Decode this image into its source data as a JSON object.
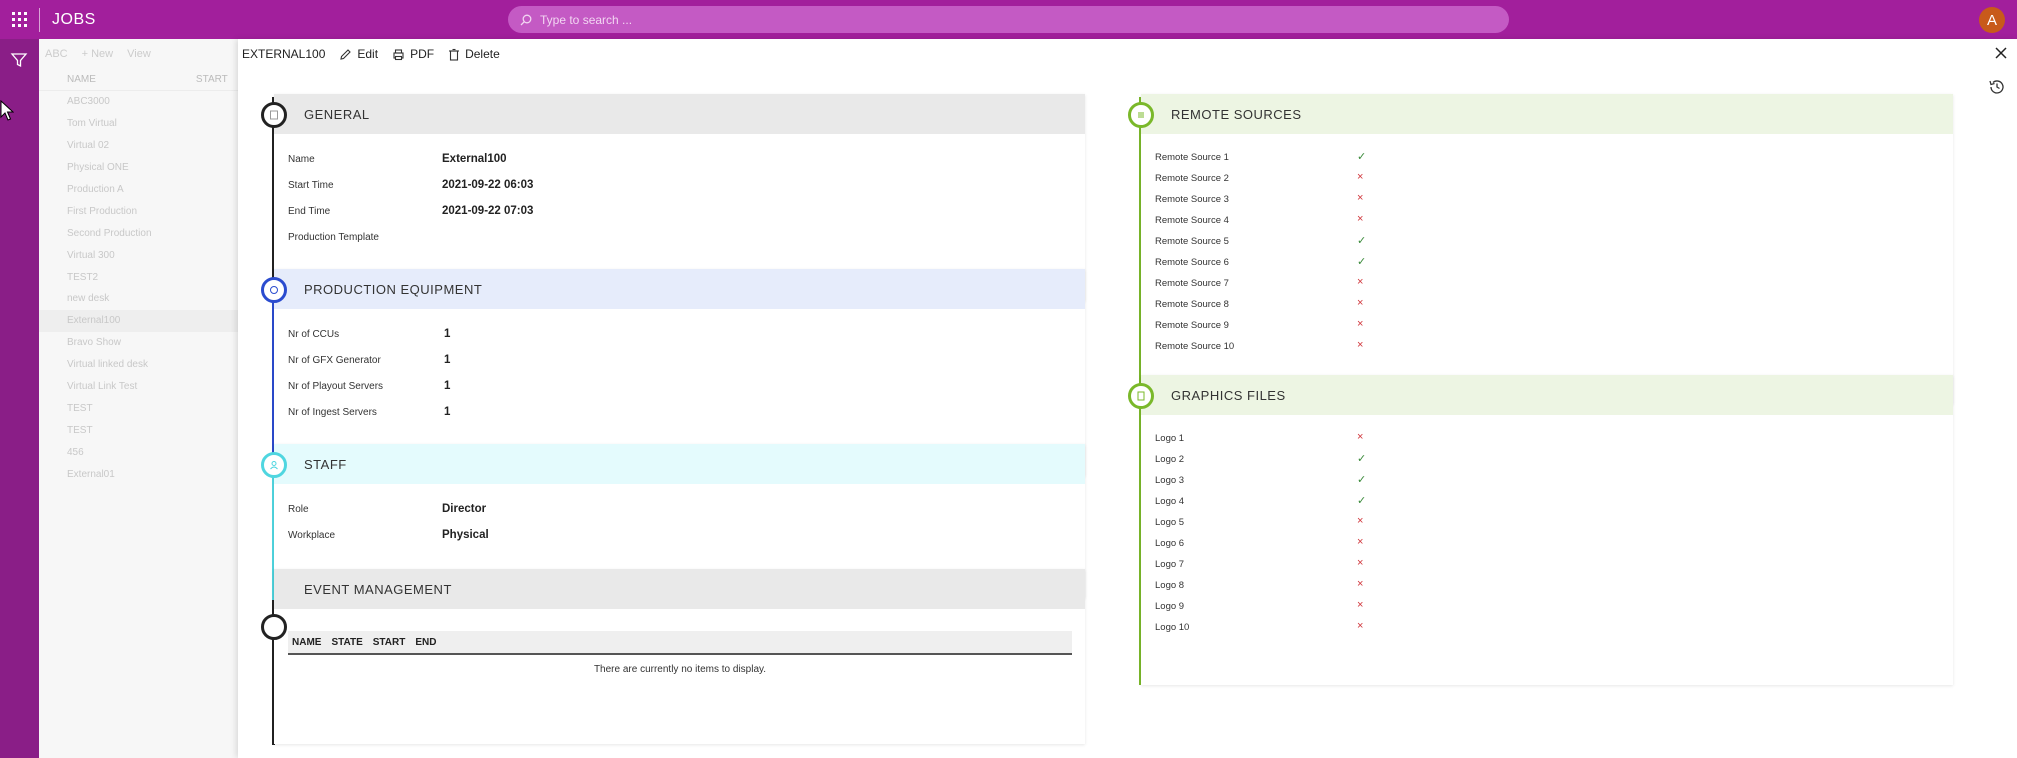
{
  "app": {
    "title": "JOBS",
    "search_placeholder": "Type to search ...",
    "avatar_initial": "A"
  },
  "list": {
    "toolbar": [
      "ABC",
      "New",
      "View"
    ],
    "columns": [
      "NAME",
      "START"
    ],
    "items": [
      "ABC3000",
      "Tom Virtual",
      "Virtual 02",
      "Physical ONE",
      "Production A",
      "First Production",
      "Second Production",
      "Virtual 300",
      "TEST2",
      "new desk",
      "External100",
      "Bravo Show",
      "Virtual linked desk",
      "Virtual Link Test",
      "TEST",
      "TEST",
      "456",
      "External01"
    ]
  },
  "detail": {
    "record": "EXTERNAL100",
    "edit": "Edit",
    "pdf": "PDF",
    "delete": "Delete"
  },
  "general": {
    "title": "GENERAL",
    "name_label": "Name",
    "name_value": "External100",
    "start_label": "Start Time",
    "start_value": "2021-09-22 06:03",
    "end_label": "End Time",
    "end_value": "2021-09-22 07:03",
    "template_label": "Production Template"
  },
  "equipment": {
    "title": "PRODUCTION EQUIPMENT",
    "ccus_label": "Nr of CCUs",
    "ccus_value": "1",
    "gfx_label": "Nr of GFX Generator",
    "gfx_value": "1",
    "playout_label": "Nr of Playout Servers",
    "playout_value": "1",
    "ingest_label": "Nr of Ingest Servers",
    "ingest_value": "1"
  },
  "staff": {
    "title": "STAFF",
    "role_label": "Role",
    "role_value": "Director",
    "workplace_label": "Workplace",
    "workplace_value": "Physical"
  },
  "events": {
    "title": "EVENT MANAGEMENT",
    "col_name": "NAME",
    "col_state": "STATE",
    "col_start": "START",
    "col_end": "END",
    "empty": "There are currently no items to display."
  },
  "remote": {
    "title": "REMOTE SOURCES",
    "rows": [
      {
        "label": "Remote Source 1",
        "ok": true
      },
      {
        "label": "Remote Source 2",
        "ok": false
      },
      {
        "label": "Remote Source 3",
        "ok": false
      },
      {
        "label": "Remote Source 4",
        "ok": false
      },
      {
        "label": "Remote Source 5",
        "ok": true
      },
      {
        "label": "Remote Source 6",
        "ok": true
      },
      {
        "label": "Remote Source 7",
        "ok": false
      },
      {
        "label": "Remote Source 8",
        "ok": false
      },
      {
        "label": "Remote Source 9",
        "ok": false
      },
      {
        "label": "Remote Source 10",
        "ok": false
      }
    ]
  },
  "graphics": {
    "title": "GRAPHICS FILES",
    "rows": [
      {
        "label": "Logo 1",
        "ok": false
      },
      {
        "label": "Logo 2",
        "ok": true
      },
      {
        "label": "Logo 3",
        "ok": true
      },
      {
        "label": "Logo 4",
        "ok": true
      },
      {
        "label": "Logo 5",
        "ok": false
      },
      {
        "label": "Logo 6",
        "ok": false
      },
      {
        "label": "Logo 7",
        "ok": false
      },
      {
        "label": "Logo 8",
        "ok": false
      },
      {
        "label": "Logo 9",
        "ok": false
      },
      {
        "label": "Logo 10",
        "ok": false
      }
    ]
  },
  "colors": {
    "brand": "#a21f9c",
    "ok": "#3a8a3a",
    "no": "#d0343a"
  }
}
